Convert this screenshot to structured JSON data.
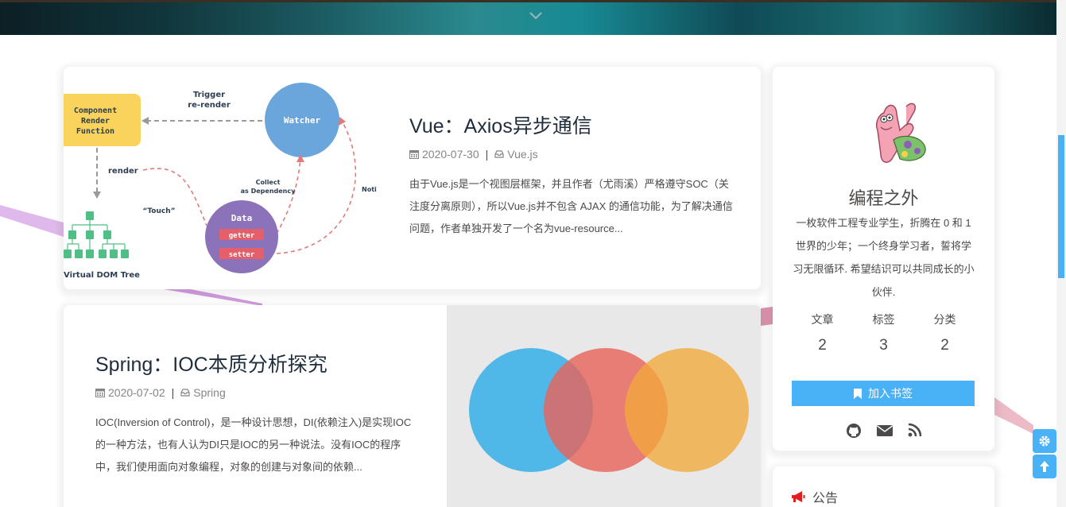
{
  "banner": {
    "scroll_icon": "chevron-down-icon"
  },
  "posts": [
    {
      "title": "Vue：Axios异步通信",
      "date": "2020-07-30",
      "separator": "|",
      "category": "Vue.js",
      "excerpt": "由于Vue.js是一个视图层框架，并且作者（尤雨溪）严格遵守SOC（关注度分离原则），所以Vue.js并不包含 AJAX 的通信功能，为了解决通信问题，作者单独开发了一个名为vue-resource...",
      "cover": {
        "component_label": [
          "Component",
          "Render",
          "Function"
        ],
        "trigger_label": [
          "Trigger",
          "re-render"
        ],
        "watcher_label": "Watcher",
        "render_label": "render",
        "collect_label": [
          "Collect",
          "as Dependency"
        ],
        "notify_label": "Noti",
        "touch_label": "“Touch”",
        "data_label": "Data",
        "getter_label": "getter",
        "setter_label": "setter",
        "vdom_label": "Virtual DOM Tree"
      }
    },
    {
      "title": "Spring：IOC本质分析探究",
      "date": "2020-07-02",
      "separator": "|",
      "category": "Spring",
      "excerpt": "IOC(Inversion of Control)，是一种设计思想，DI(依赖注入)是实现IOC的一种方法，也有人认为DI只是IOC的另一种说法。没有IOC的程序中，我们使用面向对象编程，对象的创建与对象间的依赖..."
    }
  ],
  "author": {
    "name": "编程之外",
    "description": "一枚软件工程专业学生，折腾在 0 和 1 世界的少年；一个终身学习者，誓将学习无限循环. 希望结识可以共同成长的小伙伴.",
    "stats": [
      {
        "label": "文章",
        "value": "2"
      },
      {
        "label": "标签",
        "value": "3"
      },
      {
        "label": "分类",
        "value": "2"
      }
    ],
    "bookmark_label": "加入书签",
    "social_icons": [
      "github-icon",
      "mail-icon",
      "rss-icon"
    ]
  },
  "notice": {
    "title": "公告"
  },
  "colors": {
    "accent": "#49b1f5",
    "title": "#1f2d3d",
    "text": "#4c4948",
    "meta": "#858585"
  }
}
